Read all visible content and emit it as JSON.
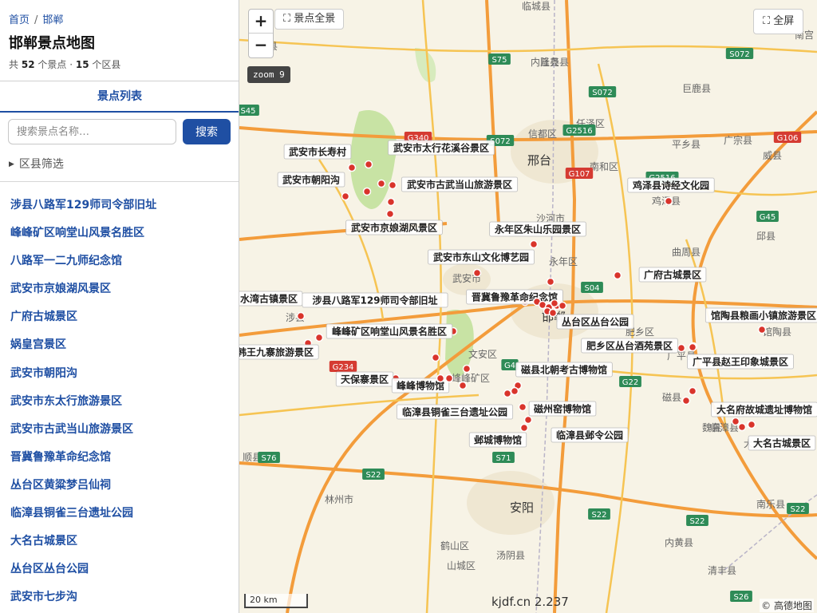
{
  "breadcrumb": {
    "home": "首页",
    "separator": "/",
    "current": "邯郸"
  },
  "page_title": "邯郸景点地图",
  "stats": {
    "prefix": "共",
    "spot_count": "52",
    "spot_unit": "个景点 ·",
    "county_count": "15",
    "county_unit": "个区县"
  },
  "tabs": {
    "list": "景点列表"
  },
  "search": {
    "placeholder": "搜索景点名称…",
    "value": "",
    "button": "搜索"
  },
  "filter": {
    "label": "区县筛选"
  },
  "list_items": [
    "涉县八路军129师司令部旧址",
    "峰峰矿区响堂山风景名胜区",
    "八路军一二九师纪念馆",
    "武安市京娘湖风景区",
    "广府古城景区",
    "娲皇宫景区",
    "武安市朝阳沟",
    "武安市东太行旅游景区",
    "武安市古武当山旅游景区",
    "晋冀鲁豫革命纪念馆",
    "丛台区黄粱梦吕仙祠",
    "临漳县铜雀三台遗址公园",
    "大名古城景区",
    "丛台区丛台公园",
    "武安市七步沟"
  ],
  "map": {
    "controls": {
      "zoom_in": "+",
      "zoom_out": "−",
      "overview": "景点全景",
      "overview_icon": "expand-icon",
      "fullscreen": "全屏",
      "fullscreen_icon": "fullscreen-icon",
      "zoom_label": "zoom 9"
    },
    "scale_label": "20 km",
    "watermark": "kjdf.cn 2.237",
    "attribution": "© 高德地图",
    "colors": {
      "motorway": "#f39c3b",
      "primary": "#f6c453",
      "poi_dot": "#d9342b",
      "shield_green": "#2e8b57",
      "shield_red": "#d53b32",
      "greenland": "#c8e3a4",
      "link": "#1f4fa3"
    },
    "cities": [
      "邢台",
      "武安市",
      "邯郸",
      "安阳",
      "临城县",
      "隆尧县",
      "内丘县",
      "任泽区",
      "南和区",
      "巨鹿县",
      "平乡县",
      "广宗县",
      "威县",
      "鸡泽县",
      "曲周县",
      "邱县",
      "永年区",
      "肥乡区",
      "馆陶县",
      "广平县",
      "涉县",
      "峰峰矿区",
      "磁县",
      "临漳县",
      "魏县",
      "大名县",
      "南乐县",
      "内黄县",
      "清丰县",
      "林州市",
      "鹤山区",
      "汤阴县",
      "山城区",
      "信都区",
      "沙河市",
      "顺县",
      "顺县",
      "南宫",
      "文安区"
    ],
    "road_shields": [
      {
        "text": "S75",
        "color": "green"
      },
      {
        "text": "S072",
        "color": "green"
      },
      {
        "text": "S072",
        "color": "green"
      },
      {
        "text": "S072",
        "color": "green"
      },
      {
        "text": "G2516",
        "color": "green"
      },
      {
        "text": "G340",
        "color": "red"
      },
      {
        "text": "G107",
        "color": "red"
      },
      {
        "text": "G2516",
        "color": "green"
      },
      {
        "text": "G106",
        "color": "red"
      },
      {
        "text": "G45",
        "color": "green"
      },
      {
        "text": "S45",
        "color": "green"
      },
      {
        "text": "S04",
        "color": "green"
      },
      {
        "text": "G234",
        "color": "red"
      },
      {
        "text": "G4",
        "color": "green"
      },
      {
        "text": "G22",
        "color": "green"
      },
      {
        "text": "S76",
        "color": "green"
      },
      {
        "text": "S22",
        "color": "green"
      },
      {
        "text": "S71",
        "color": "green"
      },
      {
        "text": "S22",
        "color": "green"
      },
      {
        "text": "S22",
        "color": "green"
      },
      {
        "text": "S22",
        "color": "green"
      },
      {
        "text": "S26",
        "color": "green"
      }
    ],
    "poi_labels": [
      "武安市长寿村",
      "武安市太行花溪谷景区",
      "武安市朝阳沟",
      "武安市古武当山旅游景区",
      "鸡泽县诗经文化园",
      "武安市京娘湖风景区",
      "永年区朱山乐园景区",
      "武安市东山文化博艺园",
      "广府古城景区",
      "水湾古镇景区",
      "涉县八路军129师司令部旧址",
      "晋冀鲁豫革命纪念馆",
      "馆陶县粮画小镇旅游景区",
      "丛台区丛台公园",
      "峰峰矿区响堂山风景名胜区",
      "肥乡区丛台酒苑景区",
      "韩王九寨旅游景区",
      "广平县赵王印象城景区",
      "天保寨景区",
      "峰峰博物馆",
      "磁县北朝考古博物馆",
      "大名府故城遗址博物馆",
      "临漳县铜雀三台遗址公园",
      "磁州窑博物馆",
      "临漳县邺令公园",
      "邺城博物馆",
      "大名古城景区"
    ]
  }
}
